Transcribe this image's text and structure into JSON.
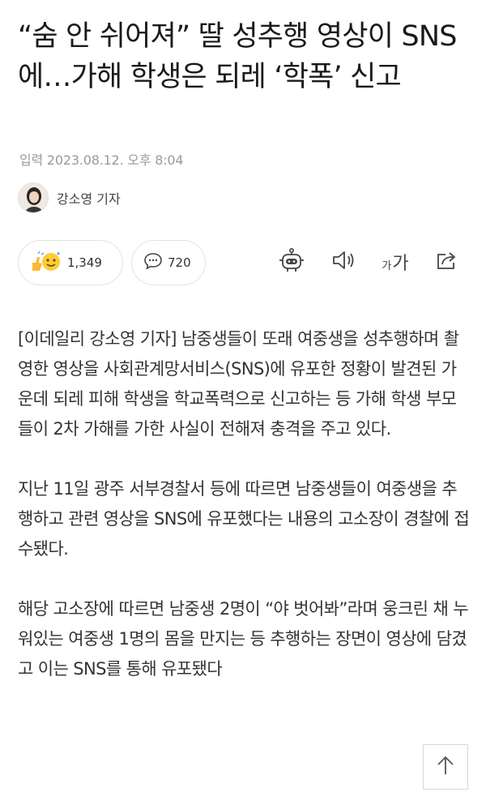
{
  "article": {
    "headline": "“숨 안 쉬어져” 딸 성추행 영상이 SNS에…가해 학생은 되레 ‘학폭’ 신고",
    "date": "입력 2023.08.12. 오후 8:04",
    "author": "강소영 기자",
    "paragraphs": [
      "[이데일리 강소영 기자] 남중생들이 또래 여중생을 성추행하며 촬영한 영상을 사회관계망서비스(SNS)에 유포한 정황이 발견된 가운데 되레 피해 학생을 학교폭력으로 신고하는 등 가해 학생 부모들이 2차 가해를 가한 사실이 전해져 충격을 주고 있다.",
      "지난 11일 광주 서부경찰서 등에 따르면 남중생들이 여중생을 추행하고 관련 영상을 SNS에 유포했다는 내용의 고소장이 경찰에 접수됐다.",
      "해당 고소장에 따르면 남중생 2명이 “야 벗어봐”라며 웅크린 채 누워있는 여중생 1명의 몸을 만지는 등 추행하는 장면이 영상에 담겼고 이는 SNS를 통해 유포됐다"
    ]
  },
  "reactions": {
    "like_count": "1,349",
    "comment_count": "720"
  },
  "toolbar": {
    "font_small": "가",
    "font_large": "가"
  },
  "icons": [
    "reaction-emoji-icon",
    "comment-bubble-icon",
    "robot-summary-icon",
    "speaker-icon",
    "font-size-icon",
    "share-icon",
    "arrow-up-icon"
  ]
}
